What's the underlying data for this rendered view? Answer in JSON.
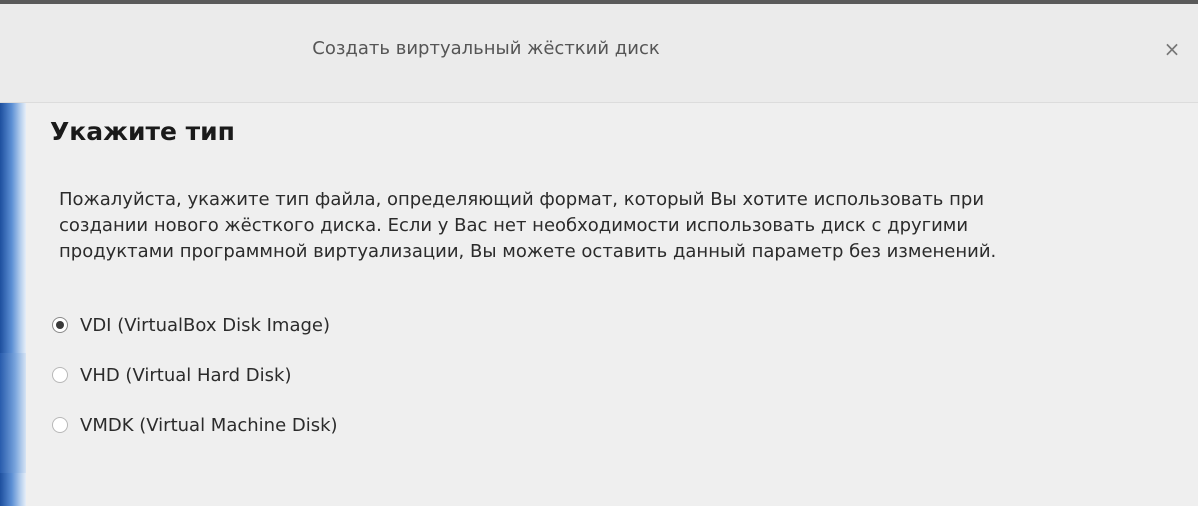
{
  "window": {
    "title": "Создать виртуальный жёсткий диск",
    "close_glyph": "×",
    "close_icon": "close-icon"
  },
  "page": {
    "title": "Укажите тип",
    "description_lines": [
      "Пожалуйста, укажите тип файла, определяющий формат, который Вы хотите использовать при",
      "создании нового жёсткого диска. Если у Вас нет необходимости использовать диск с другими",
      "продуктами программной виртуализации, Вы можете оставить данный параметр без изменений."
    ]
  },
  "options": [
    {
      "label": "VDI (VirtualBox Disk Image)",
      "selected": true
    },
    {
      "label": "VHD (Virtual Hard Disk)",
      "selected": false
    },
    {
      "label": "VMDK (Virtual Machine Disk)",
      "selected": false
    }
  ]
}
